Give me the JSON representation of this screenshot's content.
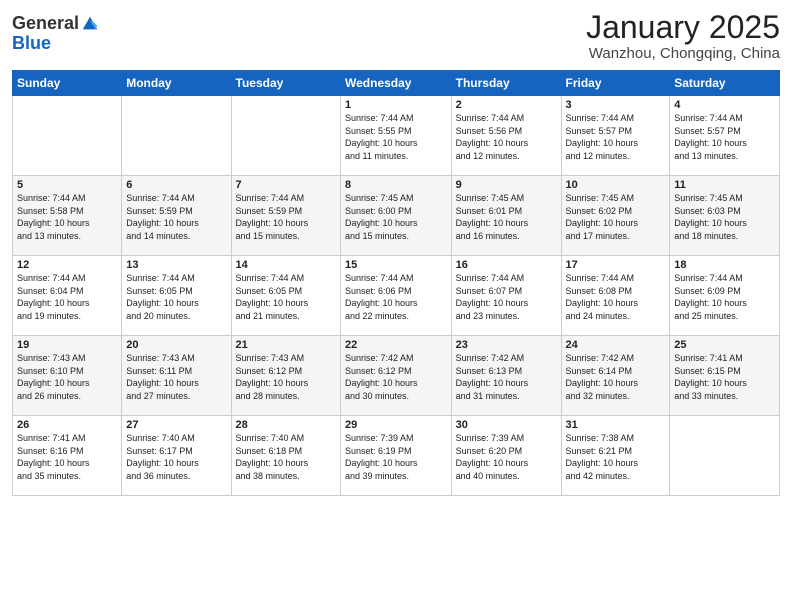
{
  "logo": {
    "general": "General",
    "blue": "Blue"
  },
  "header": {
    "month": "January 2025",
    "location": "Wanzhou, Chongqing, China"
  },
  "weekdays": [
    "Sunday",
    "Monday",
    "Tuesday",
    "Wednesday",
    "Thursday",
    "Friday",
    "Saturday"
  ],
  "weeks": [
    [
      {
        "day": "",
        "info": ""
      },
      {
        "day": "",
        "info": ""
      },
      {
        "day": "",
        "info": ""
      },
      {
        "day": "1",
        "info": "Sunrise: 7:44 AM\nSunset: 5:55 PM\nDaylight: 10 hours\nand 11 minutes."
      },
      {
        "day": "2",
        "info": "Sunrise: 7:44 AM\nSunset: 5:56 PM\nDaylight: 10 hours\nand 12 minutes."
      },
      {
        "day": "3",
        "info": "Sunrise: 7:44 AM\nSunset: 5:57 PM\nDaylight: 10 hours\nand 12 minutes."
      },
      {
        "day": "4",
        "info": "Sunrise: 7:44 AM\nSunset: 5:57 PM\nDaylight: 10 hours\nand 13 minutes."
      }
    ],
    [
      {
        "day": "5",
        "info": "Sunrise: 7:44 AM\nSunset: 5:58 PM\nDaylight: 10 hours\nand 13 minutes."
      },
      {
        "day": "6",
        "info": "Sunrise: 7:44 AM\nSunset: 5:59 PM\nDaylight: 10 hours\nand 14 minutes."
      },
      {
        "day": "7",
        "info": "Sunrise: 7:44 AM\nSunset: 5:59 PM\nDaylight: 10 hours\nand 15 minutes."
      },
      {
        "day": "8",
        "info": "Sunrise: 7:45 AM\nSunset: 6:00 PM\nDaylight: 10 hours\nand 15 minutes."
      },
      {
        "day": "9",
        "info": "Sunrise: 7:45 AM\nSunset: 6:01 PM\nDaylight: 10 hours\nand 16 minutes."
      },
      {
        "day": "10",
        "info": "Sunrise: 7:45 AM\nSunset: 6:02 PM\nDaylight: 10 hours\nand 17 minutes."
      },
      {
        "day": "11",
        "info": "Sunrise: 7:45 AM\nSunset: 6:03 PM\nDaylight: 10 hours\nand 18 minutes."
      }
    ],
    [
      {
        "day": "12",
        "info": "Sunrise: 7:44 AM\nSunset: 6:04 PM\nDaylight: 10 hours\nand 19 minutes."
      },
      {
        "day": "13",
        "info": "Sunrise: 7:44 AM\nSunset: 6:05 PM\nDaylight: 10 hours\nand 20 minutes."
      },
      {
        "day": "14",
        "info": "Sunrise: 7:44 AM\nSunset: 6:05 PM\nDaylight: 10 hours\nand 21 minutes."
      },
      {
        "day": "15",
        "info": "Sunrise: 7:44 AM\nSunset: 6:06 PM\nDaylight: 10 hours\nand 22 minutes."
      },
      {
        "day": "16",
        "info": "Sunrise: 7:44 AM\nSunset: 6:07 PM\nDaylight: 10 hours\nand 23 minutes."
      },
      {
        "day": "17",
        "info": "Sunrise: 7:44 AM\nSunset: 6:08 PM\nDaylight: 10 hours\nand 24 minutes."
      },
      {
        "day": "18",
        "info": "Sunrise: 7:44 AM\nSunset: 6:09 PM\nDaylight: 10 hours\nand 25 minutes."
      }
    ],
    [
      {
        "day": "19",
        "info": "Sunrise: 7:43 AM\nSunset: 6:10 PM\nDaylight: 10 hours\nand 26 minutes."
      },
      {
        "day": "20",
        "info": "Sunrise: 7:43 AM\nSunset: 6:11 PM\nDaylight: 10 hours\nand 27 minutes."
      },
      {
        "day": "21",
        "info": "Sunrise: 7:43 AM\nSunset: 6:12 PM\nDaylight: 10 hours\nand 28 minutes."
      },
      {
        "day": "22",
        "info": "Sunrise: 7:42 AM\nSunset: 6:12 PM\nDaylight: 10 hours\nand 30 minutes."
      },
      {
        "day": "23",
        "info": "Sunrise: 7:42 AM\nSunset: 6:13 PM\nDaylight: 10 hours\nand 31 minutes."
      },
      {
        "day": "24",
        "info": "Sunrise: 7:42 AM\nSunset: 6:14 PM\nDaylight: 10 hours\nand 32 minutes."
      },
      {
        "day": "25",
        "info": "Sunrise: 7:41 AM\nSunset: 6:15 PM\nDaylight: 10 hours\nand 33 minutes."
      }
    ],
    [
      {
        "day": "26",
        "info": "Sunrise: 7:41 AM\nSunset: 6:16 PM\nDaylight: 10 hours\nand 35 minutes."
      },
      {
        "day": "27",
        "info": "Sunrise: 7:40 AM\nSunset: 6:17 PM\nDaylight: 10 hours\nand 36 minutes."
      },
      {
        "day": "28",
        "info": "Sunrise: 7:40 AM\nSunset: 6:18 PM\nDaylight: 10 hours\nand 38 minutes."
      },
      {
        "day": "29",
        "info": "Sunrise: 7:39 AM\nSunset: 6:19 PM\nDaylight: 10 hours\nand 39 minutes."
      },
      {
        "day": "30",
        "info": "Sunrise: 7:39 AM\nSunset: 6:20 PM\nDaylight: 10 hours\nand 40 minutes."
      },
      {
        "day": "31",
        "info": "Sunrise: 7:38 AM\nSunset: 6:21 PM\nDaylight: 10 hours\nand 42 minutes."
      },
      {
        "day": "",
        "info": ""
      }
    ]
  ]
}
